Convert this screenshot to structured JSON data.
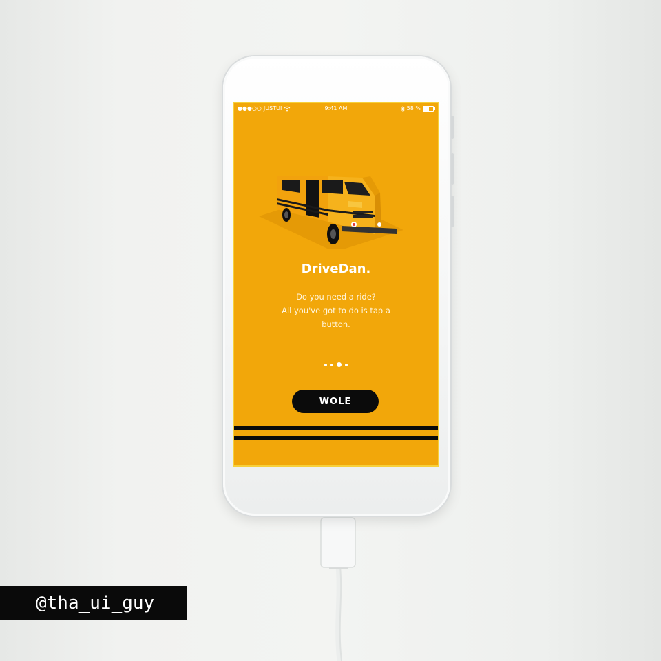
{
  "status_bar": {
    "signal_dots": "●●●○○",
    "carrier": "JUSTUI",
    "wifi_icon": "wifi-icon",
    "time": "9:41 AM",
    "bluetooth_icon": "bluetooth-icon",
    "battery_percent": "58 %",
    "battery_level": 0.58
  },
  "onboarding": {
    "illustration_icon": "van-icon",
    "title": "DriveDan.",
    "description_lines": [
      "Do you need a ride?",
      "All you've got to do is tap a",
      "button."
    ],
    "page_count": 4,
    "active_page": 2,
    "cta_label": "WOLE"
  },
  "watermark": {
    "handle": "@tha_ui_guy"
  },
  "colors": {
    "brand_yellow": "#f2a70a",
    "dark": "#0b0b0b",
    "text_light": "#ffffff"
  }
}
